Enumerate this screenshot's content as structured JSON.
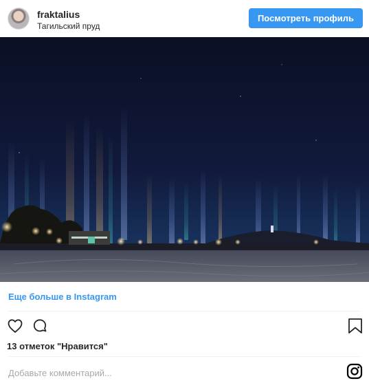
{
  "header": {
    "username": "fraktalius",
    "location": "Тагильский пруд",
    "view_profile_label": "Посмотреть профиль"
  },
  "post": {
    "more_link": "Еще больше в Instagram",
    "likes": "13 отметок \"Нравится\"",
    "comment_placeholder": "Добавьте комментарий...",
    "icons": [
      "heart-icon",
      "comment-icon",
      "bookmark-icon",
      "instagram-icon"
    ]
  },
  "colors": {
    "accent": "#3897f0",
    "text": "#262626",
    "placeholder": "#a8a8a8",
    "divider": "#efefef"
  }
}
